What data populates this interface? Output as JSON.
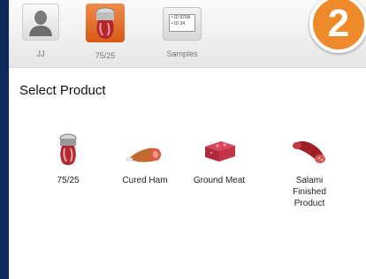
{
  "topbar": {
    "items": [
      {
        "label": "JJ",
        "icon": "user-avatar-icon"
      },
      {
        "label": "75/25",
        "icon": "meat-grinder-icon"
      },
      {
        "label": "Samples",
        "icon": "sample-id-cards-icon",
        "card_lines": [
          "• ID 670A",
          "• ID 34"
        ]
      }
    ]
  },
  "step_badge": {
    "number": "2",
    "color": "#ef8a2a"
  },
  "main": {
    "title": "Select Product",
    "products": [
      {
        "label": "75/25",
        "icon": "meat-grinder-icon"
      },
      {
        "label": "Cured Ham",
        "icon": "ham-icon"
      },
      {
        "label": "Ground Meat",
        "icon": "ground-meat-icon"
      },
      {
        "label": "Salami Finished Product",
        "label_lines": [
          "Salami",
          "Finished",
          "Product"
        ],
        "icon": "salami-icon"
      }
    ]
  },
  "colors": {
    "frame": "#0c2a5a",
    "accent": "#ef8a2a",
    "selected_tab": "#e06a22"
  }
}
